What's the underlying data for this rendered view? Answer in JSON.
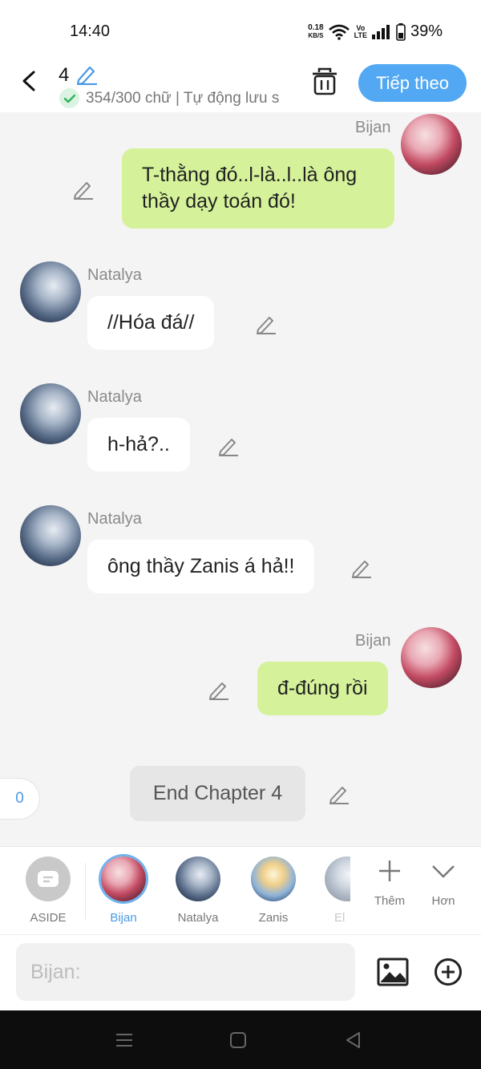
{
  "status_bar": {
    "time": "14:40",
    "net_speed_value": "0.18",
    "net_speed_unit": "KB/S",
    "volte_top": "Vo",
    "volte_bottom": "LTE",
    "battery": "39%"
  },
  "header": {
    "chapter_number": "4",
    "save_status": "354/300 chữ | Tự động lưu s",
    "next_button": "Tiếp theo"
  },
  "messages": [
    {
      "speaker": "Bijan",
      "side": "right",
      "text_line1": "T-thằng đó..l-là..l..là ông",
      "text_line2": "thầy dạy toán đó!"
    },
    {
      "speaker": "Natalya",
      "side": "left",
      "text": "//Hóa đá//"
    },
    {
      "speaker": "Natalya",
      "side": "left",
      "text": "h-hả?.."
    },
    {
      "speaker": "Natalya",
      "side": "left",
      "text": "ông thầy Zanis á hả!!"
    },
    {
      "speaker": "Bijan",
      "side": "right",
      "text": "đ-đúng rồi"
    }
  ],
  "end_chapter": "End Chapter 4",
  "counter": "0",
  "characters": [
    {
      "label": "ASIDE"
    },
    {
      "label": "Bijan",
      "selected": true
    },
    {
      "label": "Natalya"
    },
    {
      "label": "Zanis"
    },
    {
      "label": "El"
    }
  ],
  "actions": {
    "add_label": "Thêm",
    "more_label": "Hơn"
  },
  "input": {
    "placeholder": "Bijan:"
  },
  "colors": {
    "accent_blue": "#52a8f2",
    "my_bubble": "#d5f29a",
    "their_bubble": "#ffffff",
    "chat_background": "#f4f4f4"
  }
}
